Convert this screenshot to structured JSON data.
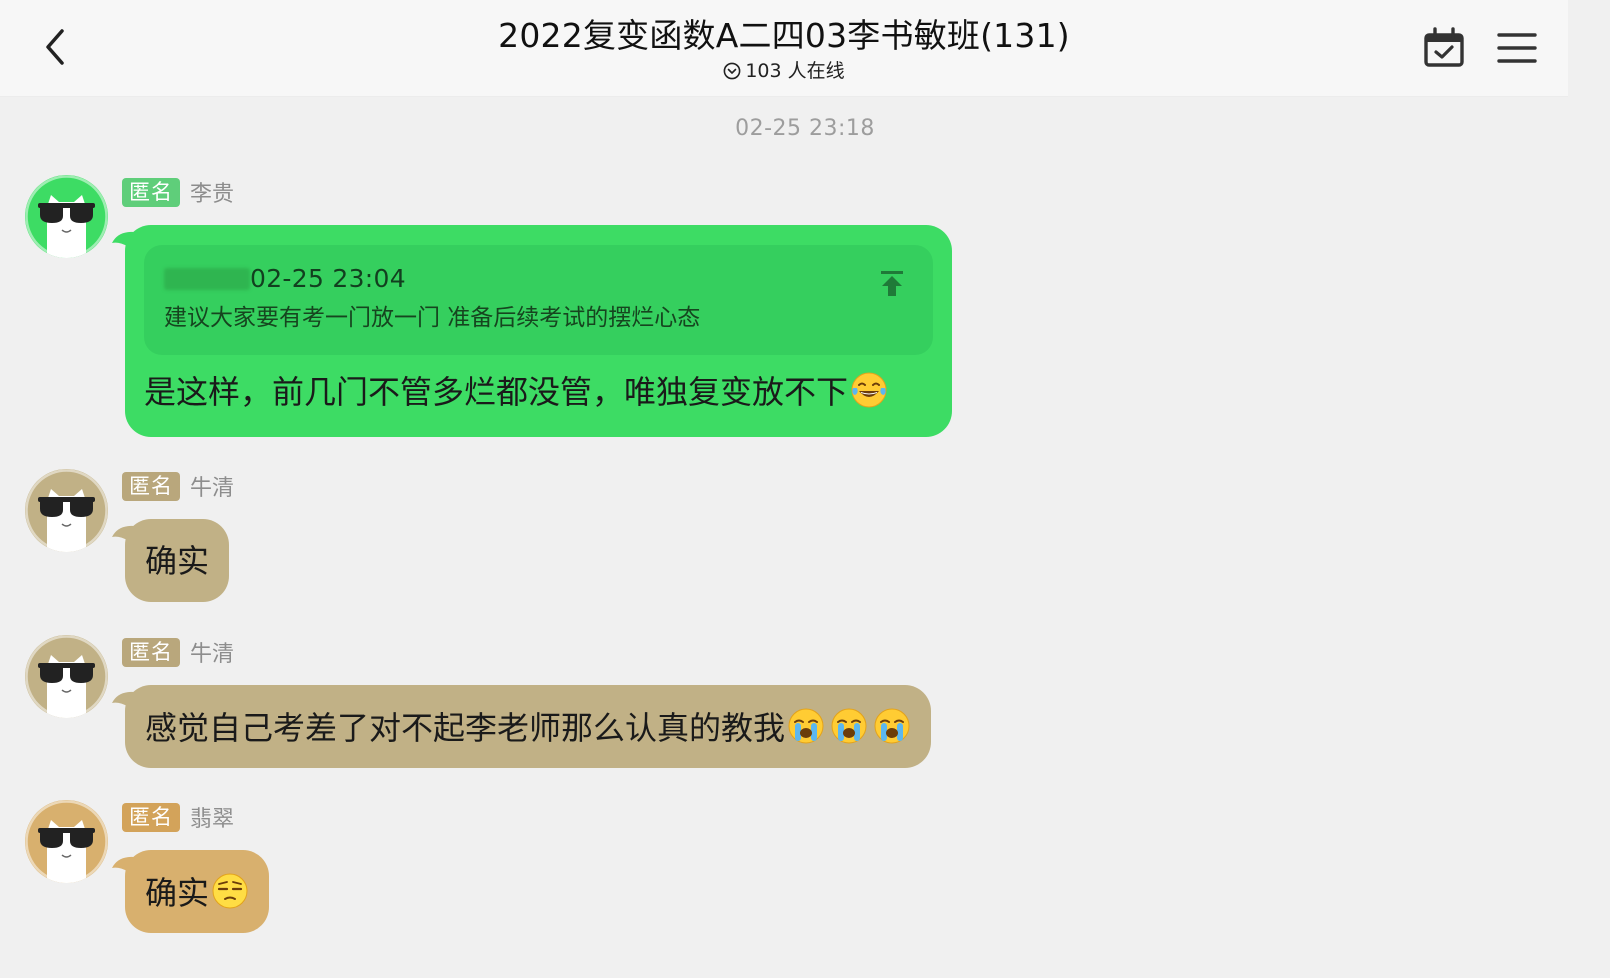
{
  "header": {
    "title": "2022复变函数A二四03李书敏班(131)",
    "online_count": "103 人在线"
  },
  "timestamp": "02-25 23:18",
  "messages": [
    {
      "tag": "匿名",
      "name": "李贵",
      "color": "#3ddc64",
      "tag_color": "#5fce7a",
      "quote": {
        "time": "02-25 23:04",
        "text": "建议大家要有考一门放一门 准备后续考试的摆烂心态"
      },
      "text": "是这样，前几门不管多烂都没管，唯独复变放不下",
      "emojis": [
        "laugh-tears-emoji"
      ]
    },
    {
      "tag": "匿名",
      "name": "牛清",
      "color": "#c1b186",
      "tag_color": "#b9a77c",
      "text": "确实",
      "emojis": []
    },
    {
      "tag": "匿名",
      "name": "牛清",
      "color": "#c1b186",
      "tag_color": "#b9a77c",
      "text": "感觉自己考差了对不起李老师那么认真的教我",
      "emojis": [
        "crying-emoji",
        "crying-emoji",
        "crying-emoji"
      ]
    },
    {
      "tag": "匿名",
      "name": "翡翠",
      "color": "#d8b06e",
      "tag_color": "#d3a35a",
      "text": "确实",
      "emojis": [
        "unamused-emoji"
      ]
    }
  ]
}
